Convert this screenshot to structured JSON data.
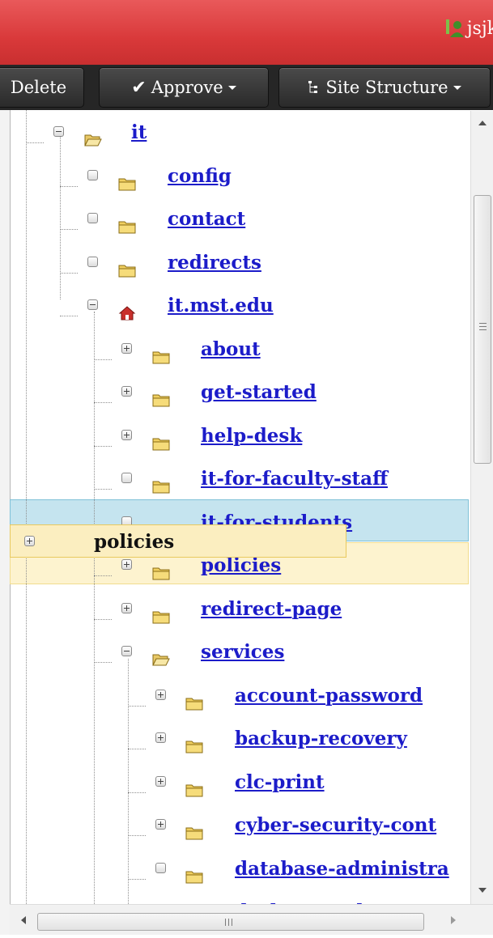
{
  "header": {
    "user_name": "jsjk",
    "user_icon": "user-icon",
    "colors": {
      "bar": "#d9393a",
      "toolbar": "#262626",
      "link": "#1c1cc9"
    }
  },
  "toolbar": {
    "delete_label": "Delete",
    "approve_label": "Approve",
    "site_structure_label": "Site Structure"
  },
  "tree": {
    "nodes": [
      {
        "label": "it",
        "expander": "collapse",
        "icon": "folder-open-icon"
      },
      {
        "label": "config",
        "expander": "leaf",
        "icon": "folder-icon"
      },
      {
        "label": "contact",
        "expander": "leaf",
        "icon": "folder-icon"
      },
      {
        "label": "redirects",
        "expander": "leaf",
        "icon": "folder-icon"
      },
      {
        "label": "it.mst.edu",
        "expander": "collapse",
        "icon": "home-icon"
      },
      {
        "label": "about",
        "expander": "expand",
        "icon": "folder-icon"
      },
      {
        "label": "get-started",
        "expander": "expand",
        "icon": "folder-icon"
      },
      {
        "label": "help-desk",
        "expander": "expand",
        "icon": "folder-icon"
      },
      {
        "label": "it-for-faculty-staff",
        "expander": "leaf",
        "icon": "folder-icon"
      },
      {
        "label": "it-for-students",
        "expander": "leaf",
        "icon": "folder-icon",
        "state": "hover"
      },
      {
        "label": "policies",
        "expander": "expand",
        "icon": "folder-icon",
        "state": "drop-target"
      },
      {
        "label": "redirect-page",
        "expander": "expand",
        "icon": "folder-icon"
      },
      {
        "label": "services",
        "expander": "collapse",
        "icon": "folder-open-icon"
      },
      {
        "label": "account-password",
        "expander": "expand",
        "icon": "folder-icon"
      },
      {
        "label": "backup-recovery",
        "expander": "expand",
        "icon": "folder-icon"
      },
      {
        "label": "clc-print",
        "expander": "expand",
        "icon": "folder-icon"
      },
      {
        "label": "cyber-security-cont",
        "expander": "expand",
        "icon": "folder-icon"
      },
      {
        "label": "database-administra",
        "expander": "leaf",
        "icon": "folder-icon"
      },
      {
        "label": "desktop-and-",
        "expander": "expand",
        "icon": "folder-icon"
      }
    ],
    "drag_proxy": {
      "label": "policies",
      "expander": "expand"
    }
  }
}
